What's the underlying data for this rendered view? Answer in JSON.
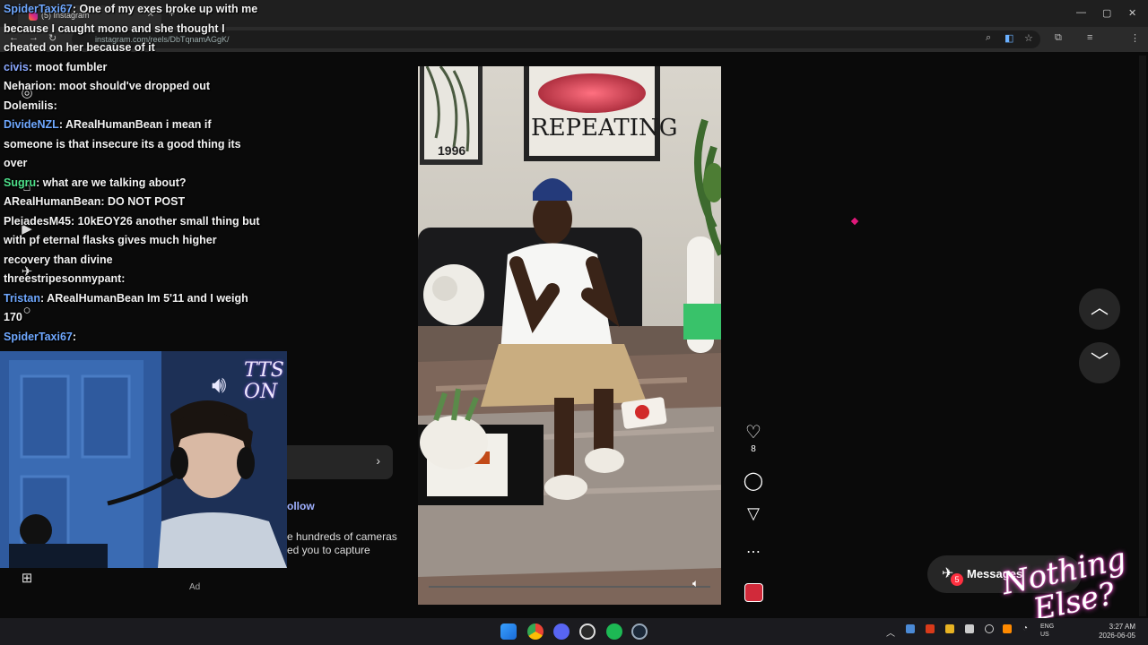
{
  "browser": {
    "tab_title": "(5) Instagram",
    "url": "instagram.com/reels/DbTqnamAGgK/"
  },
  "chat": {
    "lines": [
      {
        "user": "SpiderTaxi67",
        "color": "#6fa8ff",
        "text": ": One of my exes broke up with me because I caught mono and she thought I cheated on her because of it"
      },
      {
        "user": "civis",
        "color": "#8aa8ff",
        "text": ": moot fumbler"
      },
      {
        "user": "Neharion",
        "color": "#f2f2f2",
        "text": ": moot should've dropped out"
      },
      {
        "user": "Dolemilis",
        "color": "#f2f2f2",
        "text": ":"
      },
      {
        "user": "DivideNZL",
        "color": "#6fa8ff",
        "text": ": ARealHumanBean   i mean if someone is that insecure its a good thing its over"
      },
      {
        "user": "Sugru",
        "color": "#4ee08a",
        "text": ": what are we talking about?"
      },
      {
        "user": "ARealHumanBean",
        "color": "#f2f2f2",
        "text": ": DO NOT POST"
      },
      {
        "user": "PleiadesM45",
        "color": "#f2f2f2",
        "text": ": 10kEOY26 another small thing but with pf eternal flasks gives much higher recovery than divine"
      },
      {
        "user": "threestripesonmypant",
        "color": "#f2f2f2",
        "text": ":"
      },
      {
        "user": "Tristan",
        "color": "#6fa8ff",
        "text": ": ARealHumanBean Im 5'11 and I weigh 170"
      },
      {
        "user": "SpiderTaxi67",
        "color": "#6fa8ff",
        "text": ":"
      }
    ]
  },
  "overlay": {
    "cam_text_line1": "TTS",
    "cam_text_line2": "ON",
    "logo_line1": "Nothing",
    "logo_line2": "Else?"
  },
  "reel": {
    "poster_text": "REPEATING",
    "year_text": "1996",
    "like_count": "8",
    "follow_label": "ollow",
    "caption_line1": "e hundreds of cameras",
    "caption_line2": "ed you to capture",
    "ad_label": "Ad"
  },
  "messages": {
    "label": "Messages",
    "badge": "5"
  },
  "taskbar": {
    "time": "3:27 AM",
    "date": "2026-06-05",
    "lang": "ENG",
    "region": "US"
  }
}
